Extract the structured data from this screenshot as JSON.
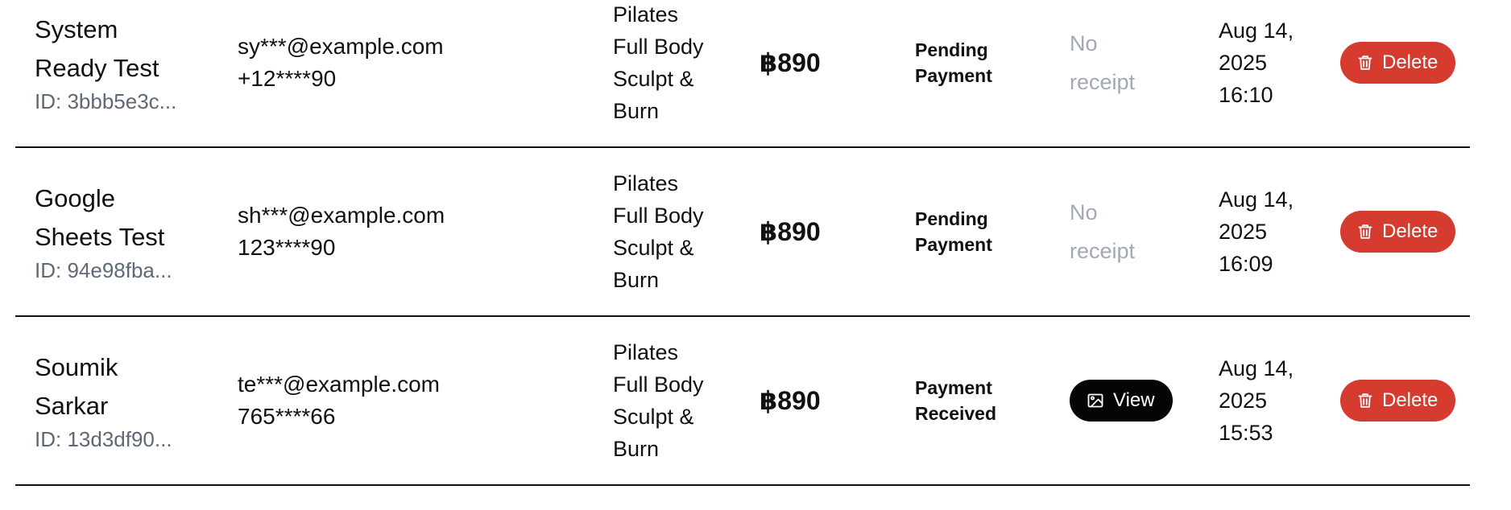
{
  "colors": {
    "delete_button": "#d63b30",
    "view_button": "#050505",
    "muted_text": "#a3a9b2",
    "id_text": "#5f6875",
    "row_divider": "#111111"
  },
  "rows": [
    {
      "name_line1": "System",
      "name_line2": "Ready Test",
      "id": "ID: 3bbb5e3c...",
      "email": "sy***@example.com",
      "phone": "+12****90",
      "class_lines": [
        "Pilates",
        "Full Body",
        "Sculpt &",
        "Burn"
      ],
      "amount": "฿890",
      "status_line1": "Pending",
      "status_line2": "Payment",
      "receipt_line1": "No",
      "receipt_line2": "receipt",
      "date_line1": "Aug 14,",
      "date_line2": "2025",
      "date_line3": "16:10",
      "action_label": "Delete",
      "action_icon": "trash-icon"
    },
    {
      "name_line1": "Google",
      "name_line2": "Sheets Test",
      "id": "ID: 94e98fba...",
      "email": "sh***@example.com",
      "phone": "123****90",
      "class_lines": [
        "Pilates",
        "Full Body",
        "Sculpt &",
        "Burn"
      ],
      "amount": "฿890",
      "status_line1": "Pending",
      "status_line2": "Payment",
      "receipt_line1": "No",
      "receipt_line2": "receipt",
      "date_line1": "Aug 14,",
      "date_line2": "2025",
      "date_line3": "16:09",
      "action_label": "Delete",
      "action_icon": "trash-icon"
    },
    {
      "name_line1": "Soumik",
      "name_line2": "Sarkar",
      "id": "ID: 13d3df90...",
      "email": "te***@example.com",
      "phone": "765****66",
      "class_lines": [
        "Pilates",
        "Full Body",
        "Sculpt &",
        "Burn"
      ],
      "amount": "฿890",
      "status_line1": "Payment",
      "status_line2": "Received",
      "receipt_button_label": "View",
      "receipt_icon": "image-icon",
      "date_line1": "Aug 14,",
      "date_line2": "2025",
      "date_line3": "15:53",
      "action_label": "Delete",
      "action_icon": "trash-icon"
    }
  ]
}
